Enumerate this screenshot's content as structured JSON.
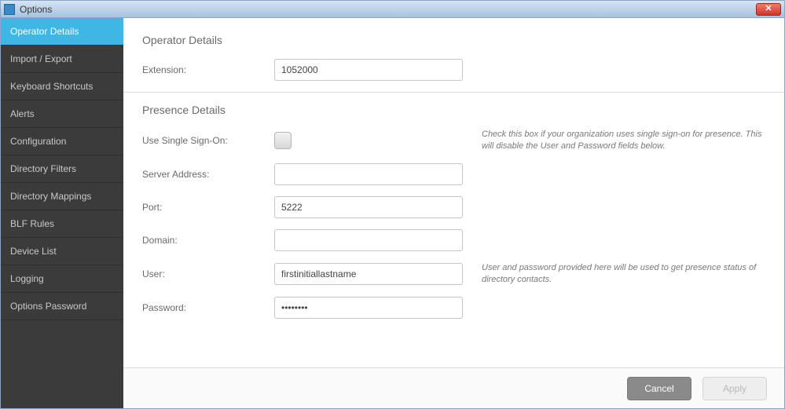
{
  "window": {
    "title": "Options"
  },
  "sidebar": {
    "items": [
      "Operator Details",
      "Import / Export",
      "Keyboard Shortcuts",
      "Alerts",
      "Configuration",
      "Directory Filters",
      "Directory Mappings",
      "BLF Rules",
      "Device List",
      "Logging",
      "Options Password"
    ],
    "selected_index": 0
  },
  "main": {
    "operator_details": {
      "title": "Operator Details",
      "extension_label": "Extension:",
      "extension_value": "1052000"
    },
    "presence_details": {
      "title": "Presence Details",
      "sso_label": "Use Single Sign-On:",
      "sso_checked": false,
      "sso_hint": "Check this box if your organization uses single sign-on for presence. This will disable the User and Password fields below.",
      "server_address_label": "Server Address:",
      "server_address_value": "",
      "port_label": "Port:",
      "port_value": "5222",
      "domain_label": "Domain:",
      "domain_value": "",
      "user_label": "User:",
      "user_value": "firstinitiallastname",
      "user_hint": "User and password provided here will be used to get presence status of directory contacts.",
      "password_label": "Password:",
      "password_value": "********"
    }
  },
  "footer": {
    "cancel_label": "Cancel",
    "apply_label": "Apply",
    "apply_enabled": false
  }
}
